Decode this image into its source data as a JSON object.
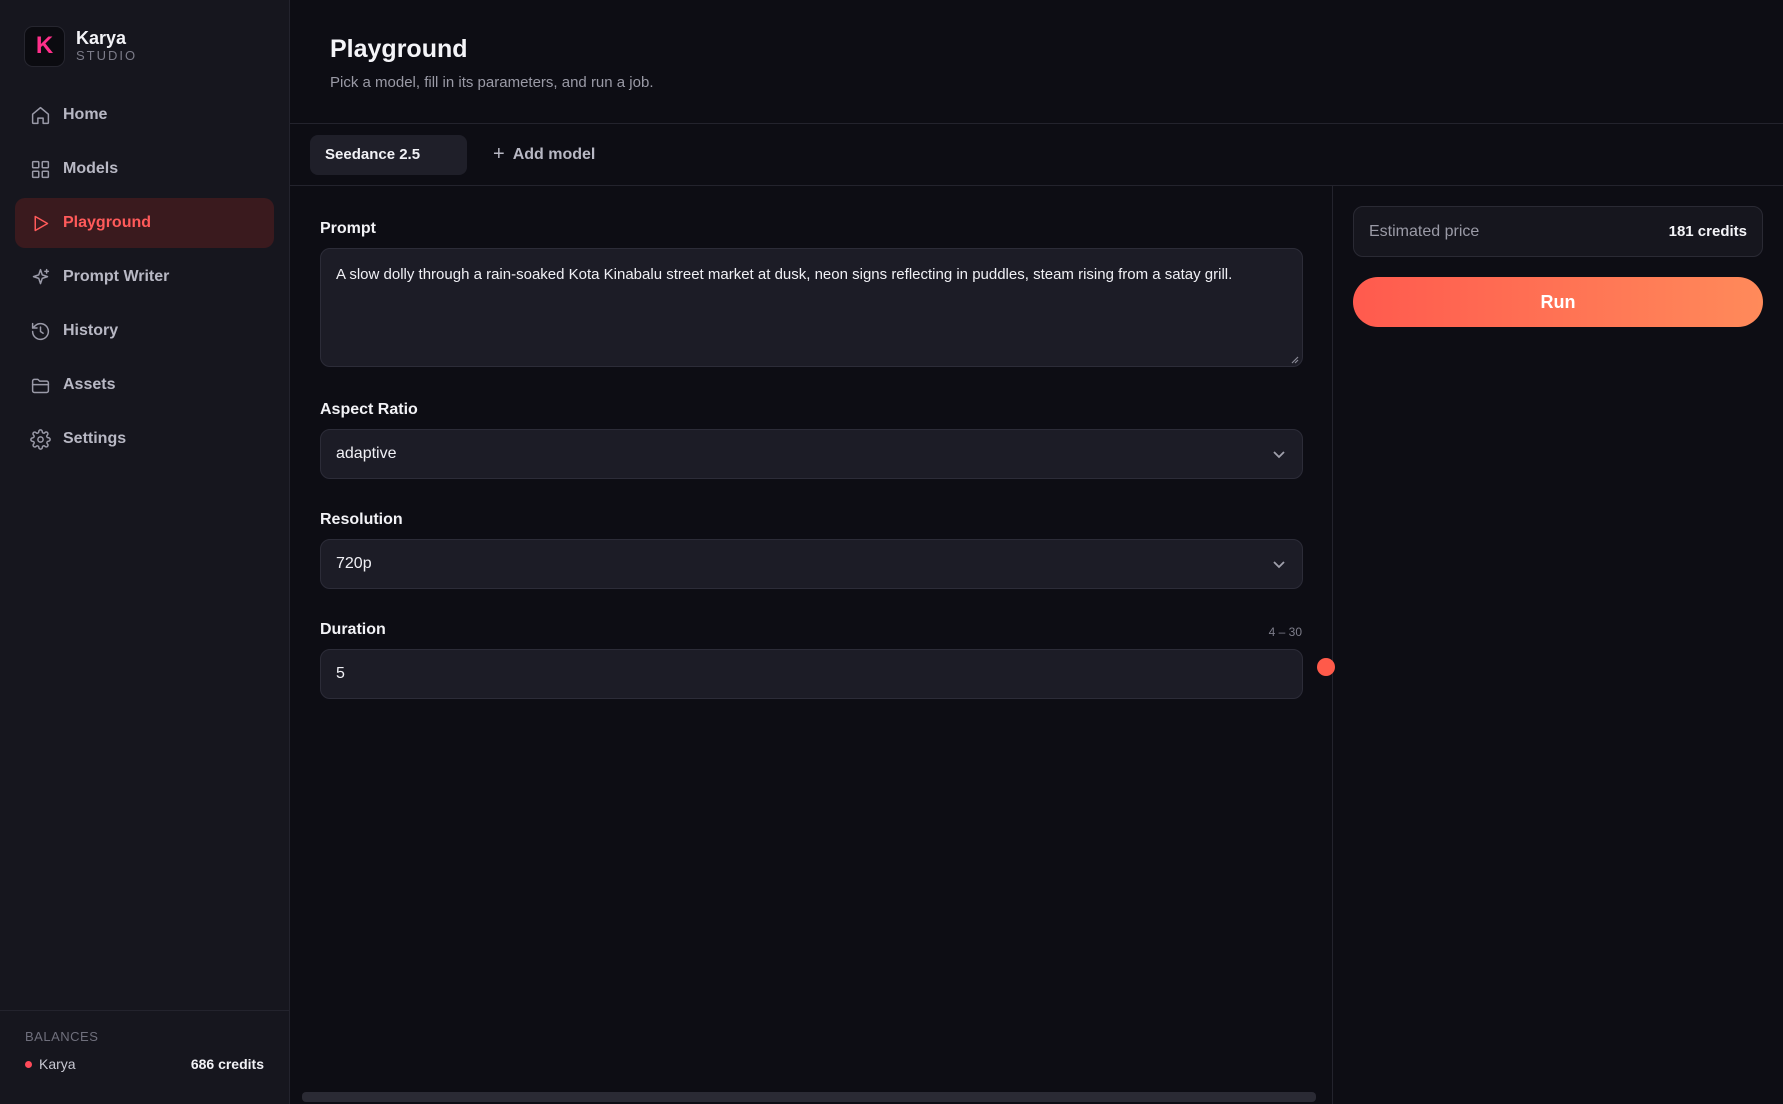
{
  "brand": {
    "name": "Karya",
    "sub": "STUDIO",
    "logo_letter": "K"
  },
  "nav": [
    {
      "label": "Home",
      "icon": "home-icon"
    },
    {
      "label": "Models",
      "icon": "grid-icon"
    },
    {
      "label": "Playground",
      "icon": "play-icon",
      "active": true
    },
    {
      "label": "Prompt Writer",
      "icon": "sparkle-icon"
    },
    {
      "label": "History",
      "icon": "history-icon"
    },
    {
      "label": "Assets",
      "icon": "folder-icon"
    },
    {
      "label": "Settings",
      "icon": "gear-icon"
    }
  ],
  "balances": {
    "title": "BALANCES",
    "account": "Karya",
    "amount": "686 credits"
  },
  "header": {
    "title": "Playground",
    "subtitle": "Pick a model, fill in its parameters, and run a job."
  },
  "tabs": {
    "active_tab": "Seedance 2.5",
    "add_label": "Add model"
  },
  "form": {
    "prompt_label": "Prompt",
    "prompt_value": "A slow dolly through a rain-soaked Kota Kinabalu street market at dusk, neon signs reflecting in puddles, steam rising from a satay grill.",
    "aspect_label": "Aspect Ratio",
    "aspect_value": "adaptive",
    "resolution_label": "Resolution",
    "resolution_value": "720p",
    "duration_label": "Duration",
    "duration_range": "4 – 30",
    "duration_value": "5"
  },
  "side": {
    "price_label": "Estimated price",
    "price_value": "181 credits",
    "run_label": "Run"
  },
  "colors": {
    "accent": "#ff5a4a",
    "active_bg": "#3a1a1e",
    "logo": "#ff2f8a"
  }
}
